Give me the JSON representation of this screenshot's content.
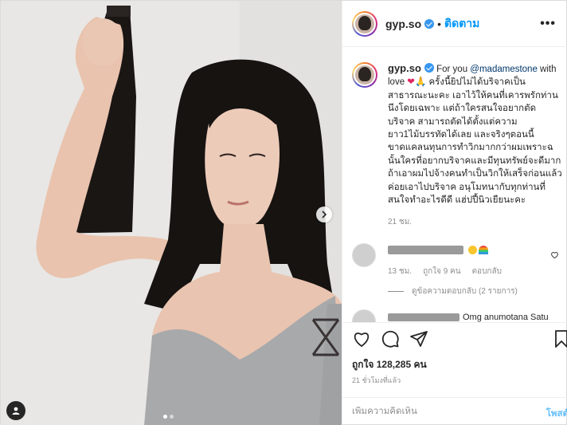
{
  "header": {
    "username": "gyp.so",
    "separator": "•",
    "follow_label": "ติดตาม",
    "more_label": "•••"
  },
  "caption": {
    "username": "gyp.so",
    "prefix": "For you ",
    "mention": "@madamestone",
    "text_start": " with love ",
    "heart": "❤",
    "hands": "🙏",
    "body": " ครั้งนี้ยิปไม่ได้บริจาคเป็นสาธารณะนะคะ เอาไว้ให้คนที่เคารพรักท่านนึงโดยเฉพาะ แต่ถ้าใครสนใจอยากตัดบริจาค สามารถตัดได้ตั้งแต่ความยาว1ไม้บรรทัดได้เลย และจริงๆตอนนี้ขาดแคลนทุนการทำวิกมากกว่าผมเพราะฉนั้นใครที่อยากบริจาคและมีทุนทรัพย์จะดีมากถ้าเอาผมไปจ้างคนทำเป็นวิกให้เสร็จก่อนแล้วค่อยเอาไปบริจาค อนุโมทนากับทุกท่านที่สนใจทำอะไรดีดี แฮ่ปปี้นิวเยียนะคะ",
    "time": "21 ชม."
  },
  "comments": [
    {
      "time": "13 ชม.",
      "likes": "ถูกใจ 9 คน",
      "reply_label": "ตอบกลับ",
      "view_replies": "ดูข้อความตอบกลับ (2 รายการ)"
    },
    {
      "text": "Omg anumotana Satu"
    }
  ],
  "actions": {
    "likes_label": "ถูกใจ 128,285 คน",
    "time_ago": "21 ชั่วโมงที่แล้ว",
    "comment_placeholder": "เพิ่มความคิดเห็น",
    "post_label": "โพสต์"
  },
  "colors": {
    "accent": "#0095f6",
    "verified": "#3897f0",
    "muted": "#8e8e8e"
  },
  "icons": [
    "heart-icon",
    "comment-icon",
    "share-icon",
    "bookmark-icon",
    "user-tag-icon",
    "chevron-right-icon",
    "verified-badge-icon"
  ]
}
